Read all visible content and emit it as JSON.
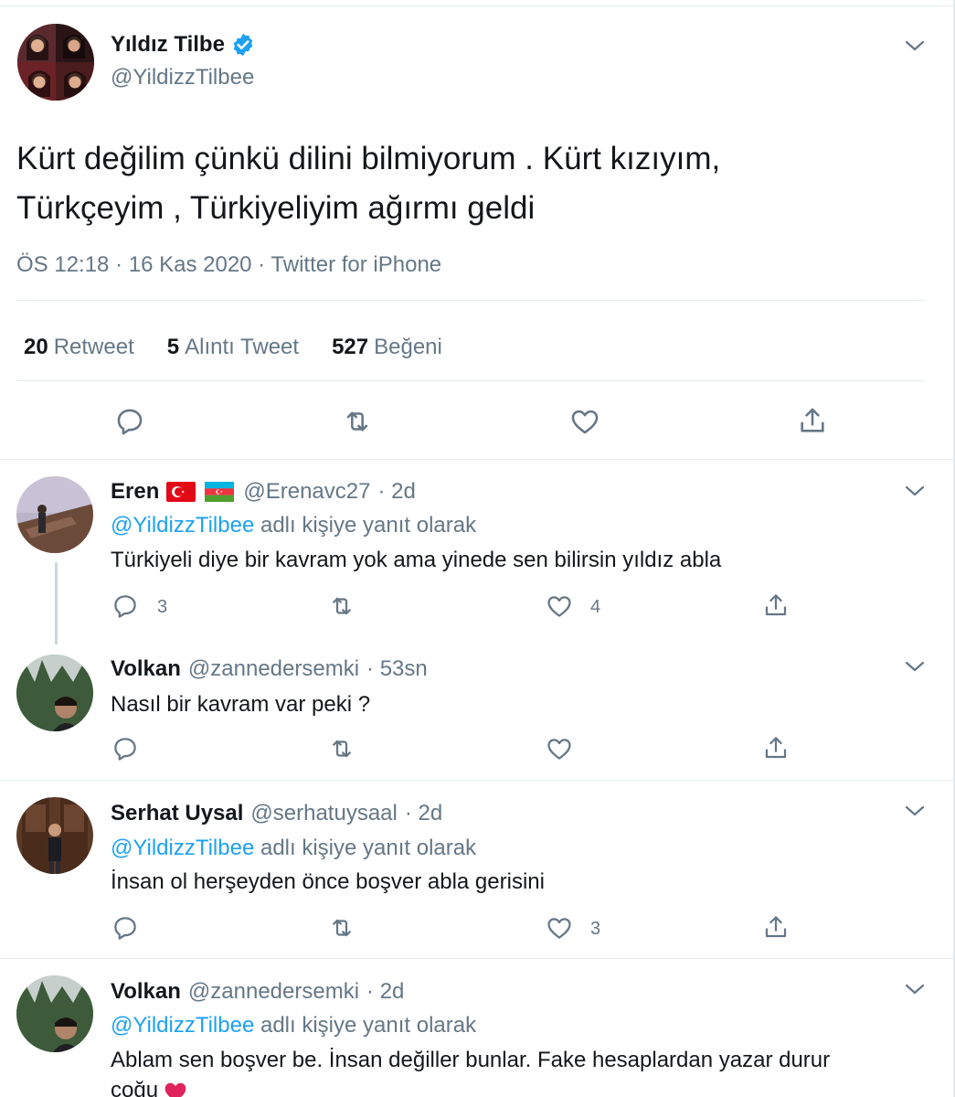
{
  "main_tweet": {
    "name": "Yıldız Tilbe",
    "handle": "@YildizzTilbee",
    "text_line1": "Kürt değilim çünkü dilini bilmiyorum . Kürt kızıyım,",
    "text_line2": "Türkçeyim , Türkiyeliyim ağırmı geldi",
    "meta": "ÖS 12:18 · 16 Kas 2020 · Twitter for iPhone",
    "stats": {
      "retweets_count": "20",
      "retweets_label": "Retweet",
      "quotes_count": "5",
      "quotes_label": "Alıntı Tweet",
      "likes_count": "527",
      "likes_label": "Beğeni"
    }
  },
  "replies": [
    {
      "name": "Eren",
      "handle": "@Erenavc27",
      "time": "· 2d",
      "reply_to_mention": "@YildizzTilbee",
      "reply_to_suffix": " adlı kişiye yanıt olarak",
      "text": "Türkiyeli diye bir kavram yok ama yinede sen bilirsin yıldız abla",
      "reply_count": "3",
      "like_count": "4"
    },
    {
      "name": "Volkan",
      "handle": "@zannedersemki",
      "time": "· 53sn",
      "text": "Nasıl bir kavram var peki ?"
    },
    {
      "name": "Serhat Uysal",
      "handle": "@serhatuysaal",
      "time": "· 2d",
      "reply_to_mention": "@YildizzTilbee",
      "reply_to_suffix": " adlı kişiye yanıt olarak",
      "text": "İnsan ol herşeyden önce boşver abla gerisini",
      "like_count": "3"
    },
    {
      "name": "Volkan",
      "handle": "@zannedersemki",
      "time": "· 2d",
      "reply_to_mention": "@YildizzTilbee",
      "reply_to_suffix": " adlı kişiye yanıt olarak",
      "text_line1": "Ablam sen boşver be. İnsan değiller bunlar. Fake hesaplardan yazar durur",
      "text_line2": "çoğu"
    }
  ],
  "colors": {
    "link": "#1da1f2",
    "secondary_text": "#657786",
    "primary_text": "#14171a",
    "heart": "#e0245e"
  },
  "icons": [
    "verified-badge-icon",
    "chevron-down-icon",
    "reply-icon",
    "retweet-icon",
    "like-icon",
    "share-icon",
    "turkey-flag-icon",
    "azerbaijan-flag-icon",
    "red-heart-emoji"
  ]
}
